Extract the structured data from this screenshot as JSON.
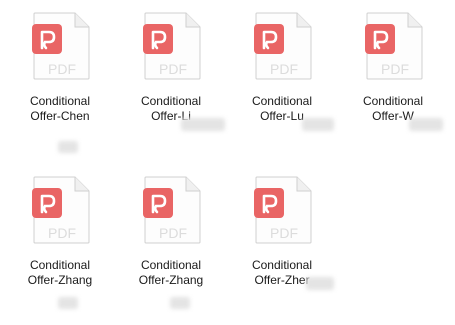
{
  "colors": {
    "pdf_brand": "#e96565",
    "pdf_text": "#dcdcdc",
    "sheet_stroke": "#d0d0d0",
    "sheet_fill": "#fdfdfd",
    "label_text": "#1a1a1a",
    "redaction": "#e4e4e4"
  },
  "icons": {
    "file_icon": "pdf-file-icon",
    "logo": "pdf-reader-logo-icon"
  },
  "files": [
    {
      "line1": "Conditional",
      "line2": "Offer-Chen",
      "badge": "PDF"
    },
    {
      "line1": "Conditional",
      "line2": "Offer-Li",
      "badge": "PDF"
    },
    {
      "line1": "Conditional",
      "line2": "Offer-Lu",
      "badge": "PDF"
    },
    {
      "line1": "Conditional",
      "line2": "Offer-W",
      "badge": "PDF"
    },
    {
      "line1": "Conditional",
      "line2": "Offer-Zhang",
      "badge": "PDF"
    },
    {
      "line1": "Conditional",
      "line2": "Offer-Zhang",
      "badge": "PDF"
    },
    {
      "line1": "Conditional",
      "line2": "Offer-Zher",
      "badge": "PDF"
    }
  ]
}
